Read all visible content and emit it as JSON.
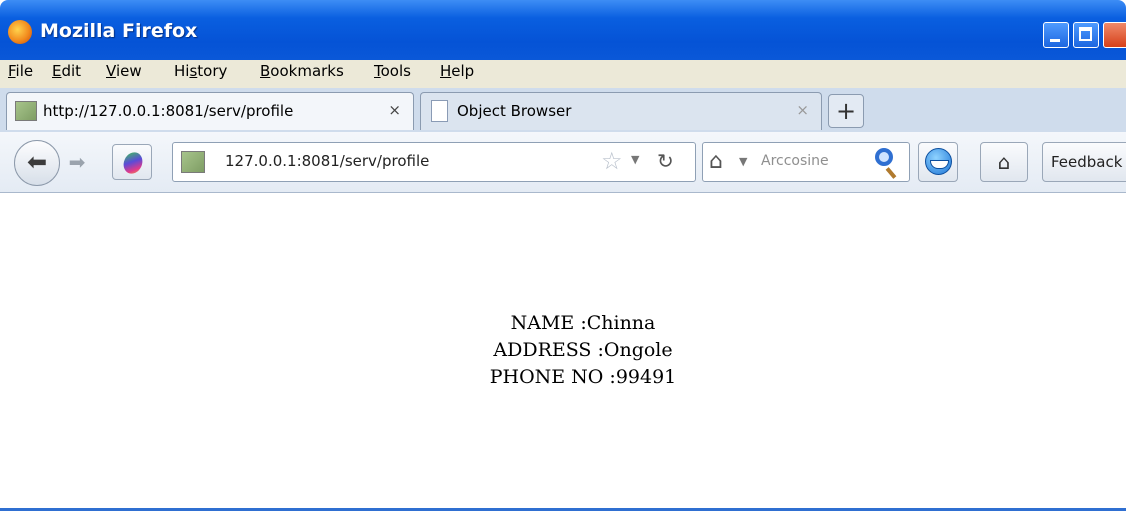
{
  "window": {
    "title": "Mozilla Firefox",
    "accent_color": "#0553d6"
  },
  "menu": [
    "File",
    "Edit",
    "View",
    "History",
    "Bookmarks",
    "Tools",
    "Help"
  ],
  "menu_underlines": [
    "F",
    "E",
    "V",
    "s",
    "B",
    "T",
    "H"
  ],
  "tabs": [
    {
      "label": "http://127.0.0.1:8081/serv/profile",
      "close": "×",
      "active": true
    },
    {
      "label": "Object Browser",
      "close": "×",
      "active": false
    }
  ],
  "new_tab_label": "+",
  "navbar": {
    "url": "127.0.0.1:8081/serv/profile",
    "search_placeholder": "Arccosine",
    "feedback_label": "Feedback"
  },
  "icons": {
    "back": "back-arrow-icon",
    "forward": "forward-arrow-icon",
    "bookmark": "star-icon",
    "reload": "reload-icon",
    "search": "magnifier-icon",
    "home": "home-icon"
  },
  "page": {
    "lines": [
      "NAME :Chinna",
      "ADDRESS :Ongole",
      "PHONE NO :99491"
    ]
  }
}
